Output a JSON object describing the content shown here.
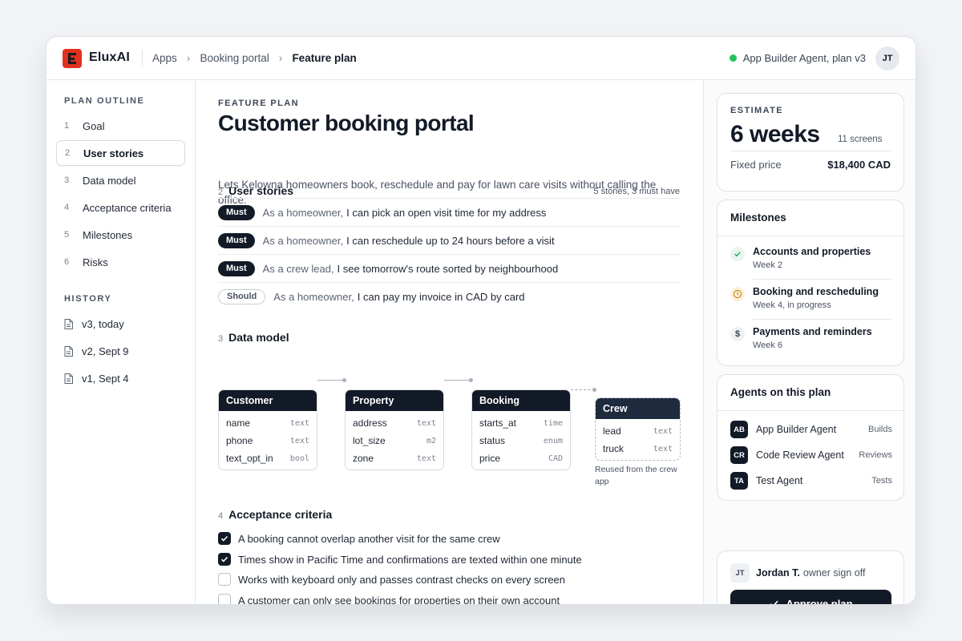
{
  "header": {
    "brand": "EluxAI",
    "breadcrumbs": [
      "Apps",
      "Booking portal",
      "Feature plan"
    ],
    "agent_status": "App Builder Agent, plan v3",
    "user_initials": "JT",
    "status_color": "#22c55e"
  },
  "sidebar": {
    "outline_heading": "PLAN OUTLINE",
    "outline": [
      {
        "num": "1",
        "label": "Goal"
      },
      {
        "num": "2",
        "label": "User stories"
      },
      {
        "num": "3",
        "label": "Data model"
      },
      {
        "num": "4",
        "label": "Acceptance criteria"
      },
      {
        "num": "5",
        "label": "Milestones"
      },
      {
        "num": "6",
        "label": "Risks"
      }
    ],
    "active_outline": "User stories",
    "history_heading": "HISTORY",
    "history": [
      "v3, today",
      "v2, Sept 9",
      "v1, Sept 4"
    ]
  },
  "main": {
    "eyebrow": "FEATURE PLAN",
    "title": "Customer booking portal",
    "subtitle": "Lets Kelowna homeowners book, reschedule and pay for lawn care visits without calling the office.",
    "stories": {
      "num": "2",
      "title": "User stories",
      "meta": "5 stories, 3 must have",
      "items": [
        {
          "priority": "Must",
          "role": "As a homeowner,",
          "text": "I can pick an open visit time for my address"
        },
        {
          "priority": "Must",
          "role": "As a homeowner,",
          "text": "I can reschedule up to 24 hours before a visit"
        },
        {
          "priority": "Must",
          "role": "As a crew lead,",
          "text": "I see tomorrow's route sorted by neighbourhood"
        },
        {
          "priority": "Should",
          "role": "As a homeowner,",
          "text": "I can pay my invoice in CAD by card"
        }
      ]
    },
    "data_model": {
      "num": "3",
      "title": "Data model",
      "entities": [
        {
          "name": "Customer",
          "fields": [
            {
              "name": "name",
              "type": "text"
            },
            {
              "name": "phone",
              "type": "text"
            },
            {
              "name": "text_opt_in",
              "type": "bool"
            }
          ]
        },
        {
          "name": "Property",
          "fields": [
            {
              "name": "address",
              "type": "text"
            },
            {
              "name": "lot_size",
              "type": "m2"
            },
            {
              "name": "zone",
              "type": "text"
            }
          ]
        },
        {
          "name": "Booking",
          "fields": [
            {
              "name": "starts_at",
              "type": "time"
            },
            {
              "name": "status",
              "type": "enum"
            },
            {
              "name": "price",
              "type": "CAD"
            }
          ]
        },
        {
          "name": "Crew",
          "fields": [
            {
              "name": "lead",
              "type": "text"
            },
            {
              "name": "truck",
              "type": "text"
            }
          ]
        }
      ],
      "reuse_note": "Reused from the crew app"
    },
    "criteria": {
      "num": "4",
      "title": "Acceptance criteria",
      "items": [
        {
          "text": "A booking cannot overlap another visit for the same crew",
          "checked": true
        },
        {
          "text": "Times show in Pacific Time and confirmations are texted within one minute",
          "checked": true
        },
        {
          "text": "Works with keyboard only and passes contrast checks on every screen",
          "checked": false
        },
        {
          "text": "A customer can only see bookings for properties on their own account",
          "checked": false
        }
      ]
    }
  },
  "right": {
    "estimate": {
      "eyebrow": "ESTIMATE",
      "duration": "6 weeks",
      "screens": "11 screens",
      "price_label": "Fixed price",
      "price_value": "$18,400 CAD"
    },
    "milestones": {
      "title": "Milestones",
      "items": [
        {
          "title": "Accounts and properties",
          "sub": "Week 2",
          "state": "done",
          "icon": "check-icon"
        },
        {
          "title": "Booking and rescheduling",
          "sub": "Week 4, in progress",
          "state": "in-progress",
          "icon": "clock-icon"
        },
        {
          "title": "Payments and reminders",
          "sub": "Week 6",
          "state": "upcoming",
          "icon": "dollar-icon"
        }
      ]
    },
    "agents": {
      "title": "Agents on this plan",
      "items": [
        {
          "initials": "AB",
          "name": "App Builder Agent",
          "role": "Builds"
        },
        {
          "initials": "CR",
          "name": "Code Review Agent",
          "role": "Reviews"
        },
        {
          "initials": "TA",
          "name": "Test Agent",
          "role": "Tests"
        }
      ]
    },
    "signoff": {
      "initials": "JT",
      "name": "Jordan T.",
      "role": "owner sign off",
      "button": "Approve plan"
    }
  }
}
